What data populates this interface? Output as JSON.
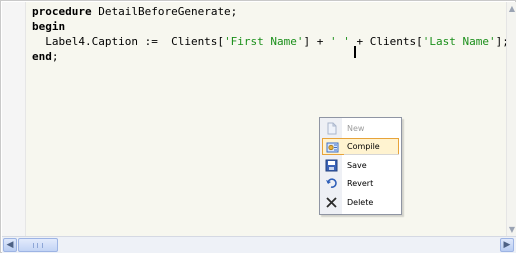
{
  "code": {
    "line1": {
      "kw": "procedure",
      "rest": " DetailBeforeGenerate;"
    },
    "line2": {
      "kw": "begin"
    },
    "line3": {
      "pre": "  Label4.Caption :=  Clients[",
      "s1": "'First Name'",
      "mid1": "] + ",
      "s2": "' '",
      "mid2": " + Clients[",
      "s3": "'Last Name'",
      "post": "];"
    },
    "line4": {
      "kw": "end",
      "rest": ";"
    }
  },
  "context_menu": {
    "items": [
      {
        "label": "New",
        "icon": "new-document-icon",
        "enabled": false
      },
      {
        "label": "Compile",
        "icon": "compile-icon",
        "enabled": true,
        "highlighted": true
      },
      {
        "label": "Save",
        "icon": "save-disk-icon",
        "enabled": true
      },
      {
        "label": "Revert",
        "icon": "undo-arrow-icon",
        "enabled": true
      },
      {
        "label": "Delete",
        "icon": "delete-x-icon",
        "enabled": true
      }
    ]
  },
  "colors": {
    "keyword": "#000000",
    "string": "#1a8f1a",
    "editor_bg": "#f7f7ef",
    "highlight": "#fff3d0"
  }
}
